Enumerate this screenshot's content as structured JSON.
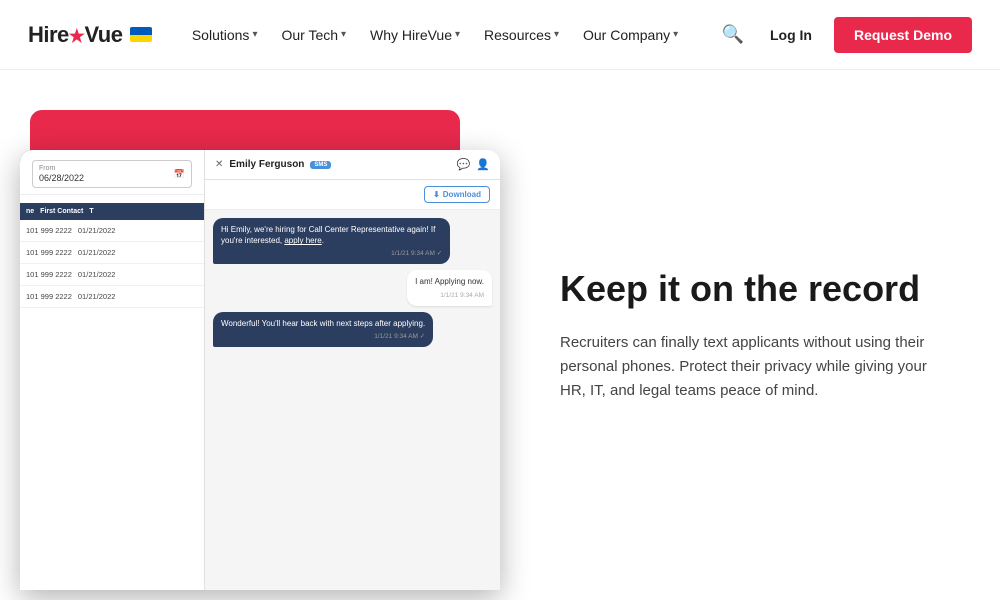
{
  "nav": {
    "logo": "HireVue",
    "items": [
      {
        "label": "Solutions",
        "has_dropdown": true
      },
      {
        "label": "Our Tech",
        "has_dropdown": true
      },
      {
        "label": "Why HireVue",
        "has_dropdown": true
      },
      {
        "label": "Resources",
        "has_dropdown": true
      },
      {
        "label": "Our Company",
        "has_dropdown": true
      }
    ],
    "login_label": "Log In",
    "demo_label": "Request Demo"
  },
  "screen": {
    "date_label": "From",
    "date_value": "06/28/2022",
    "table_headers": [
      "ne",
      "First Contact",
      "T"
    ],
    "table_rows": [
      {
        "phone": "101 999 2222",
        "date": "01/21/2022"
      },
      {
        "phone": "101 999 2222",
        "date": "01/21/2022"
      },
      {
        "phone": "101 999 2222",
        "date": "01/21/2022"
      },
      {
        "phone": "101 999 2222",
        "date": "01/21/2022"
      }
    ],
    "chat_name": "Emily Ferguson",
    "chat_badge": "SMS",
    "download_label": "Download",
    "messages": [
      {
        "type": "out",
        "text": "Hi Emily, we're hiring for Call Center Representative again! If you're interested, apply here.",
        "time": "1/1/21 9:34 AM"
      },
      {
        "type": "in",
        "text": "I am! Applying now.",
        "time": "1/1/21 9:34 AM"
      },
      {
        "type": "out",
        "text": "Wonderful! You'll hear back with next steps after applying.",
        "time": "1/1/21 9:34 AM"
      }
    ]
  },
  "content": {
    "headline": "Keep it on the record",
    "body": "Recruiters can finally text applicants without using their personal phones. Protect their privacy while giving your HR, IT, and legal teams peace of mind."
  }
}
